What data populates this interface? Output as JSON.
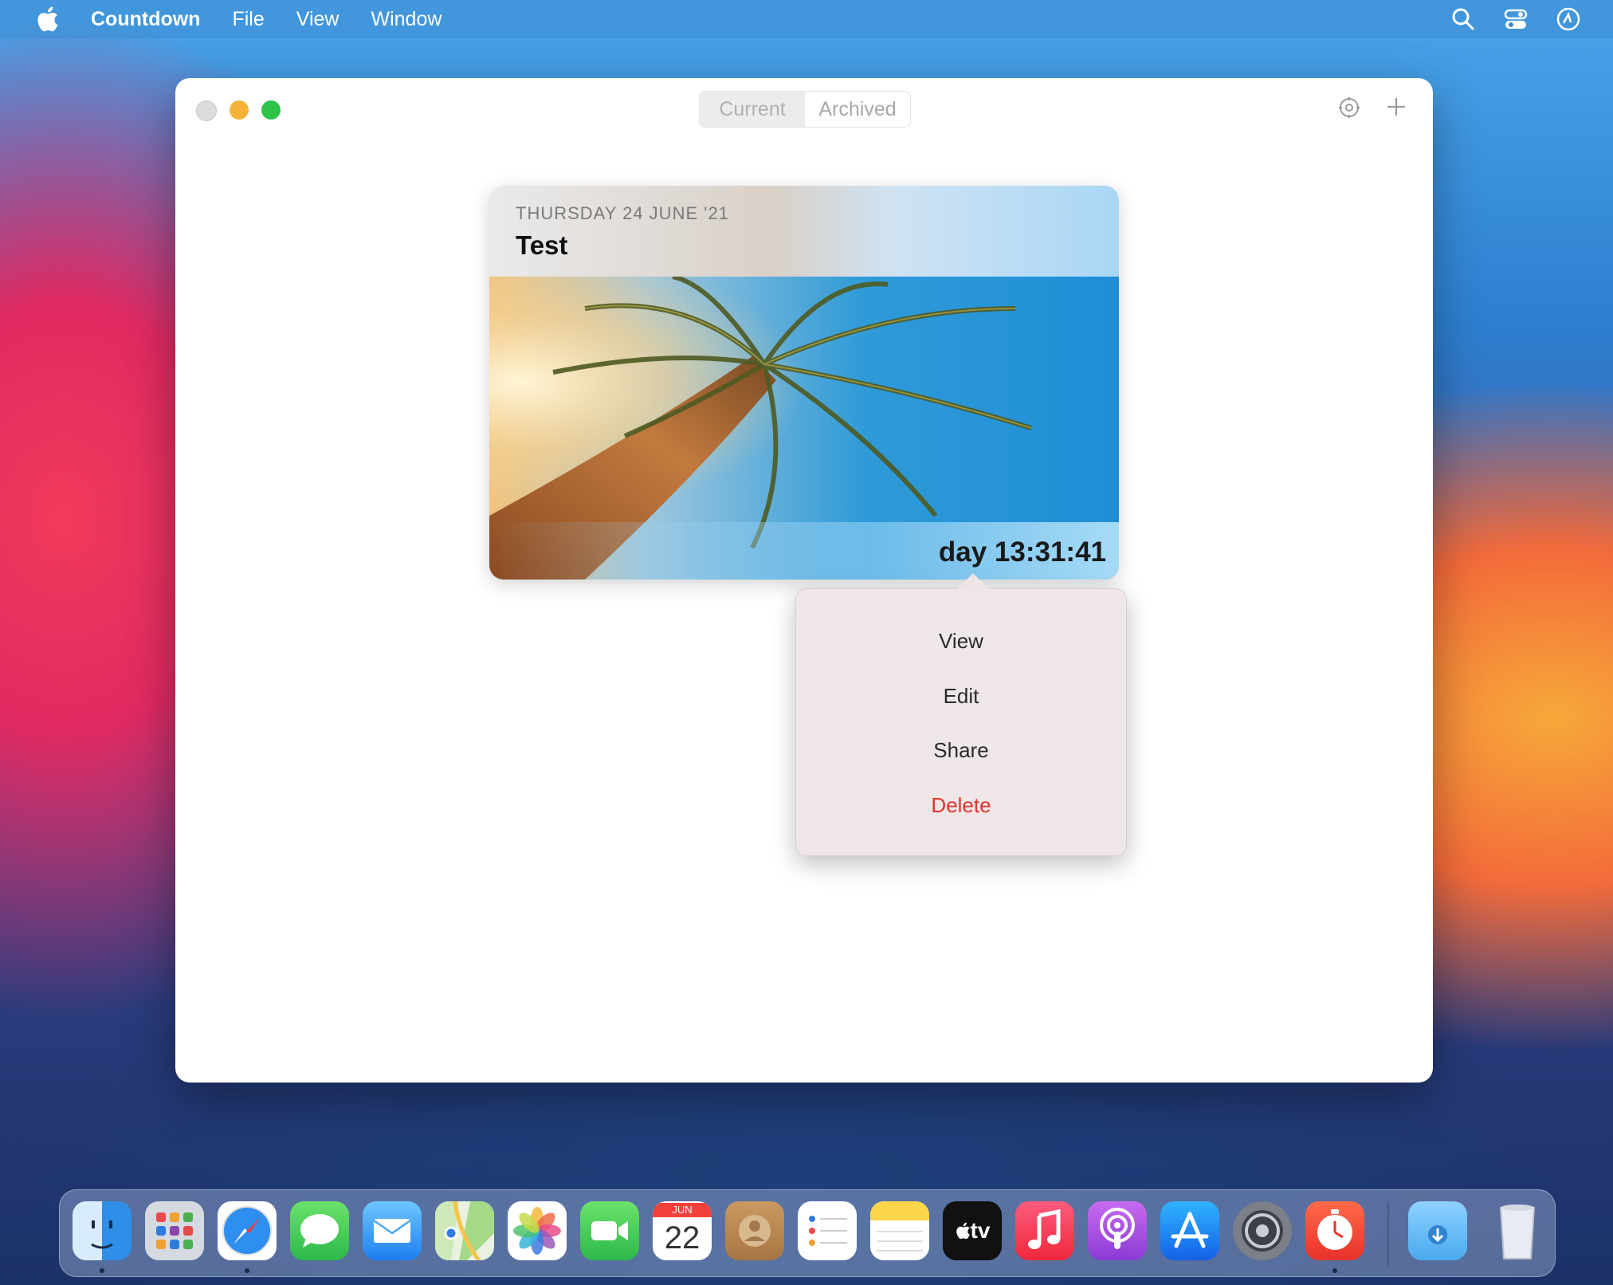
{
  "menubar": {
    "app_name": "Countdown",
    "items": [
      "File",
      "View",
      "Window"
    ],
    "icons": [
      "search-icon",
      "control-center-icon",
      "siri-icon"
    ]
  },
  "window": {
    "tabs": [
      {
        "label": "Current",
        "selected": true
      },
      {
        "label": "Archived",
        "selected": false
      }
    ],
    "toolbar_icons": [
      "settings-icon",
      "add-icon"
    ]
  },
  "card": {
    "date": "THURSDAY 24 JUNE '21",
    "title": "Test",
    "countdown": "day 13:31:41"
  },
  "context_menu": {
    "items": [
      {
        "label": "View"
      },
      {
        "label": "Edit"
      },
      {
        "label": "Share"
      },
      {
        "label": "Delete",
        "destructive": true
      }
    ],
    "destructive_color": "#e0362f"
  },
  "dock": {
    "apps": [
      "Finder",
      "Launchpad",
      "Safari",
      "Messages",
      "Mail",
      "Maps",
      "Photos",
      "FaceTime",
      "Calendar",
      "Contacts",
      "Reminders",
      "Notes",
      "TV",
      "Music",
      "Podcasts",
      "App Store",
      "System Preferences",
      "Countdown",
      "Downloads",
      "Trash"
    ],
    "calendar_month": "JUN",
    "calendar_day": "22",
    "tv_label": "tv"
  },
  "colors": {
    "accent_red": "#e0362f",
    "traffic_close": "#dcdcdc",
    "traffic_minimize": "#f5b33a",
    "traffic_zoom": "#2dc248"
  }
}
